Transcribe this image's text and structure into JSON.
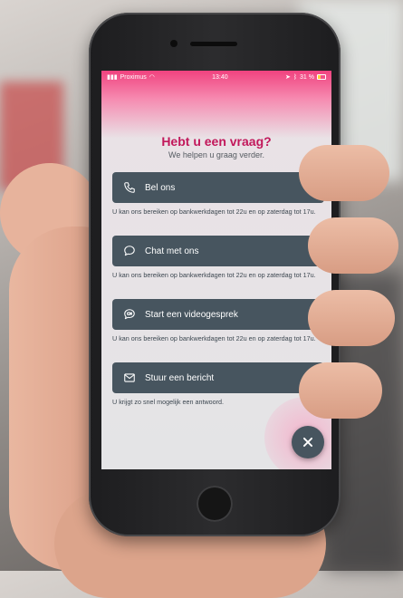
{
  "status_bar": {
    "carrier": "Proximus",
    "time": "13:40",
    "battery": "31 %"
  },
  "header": {
    "title": "Hebt u een vraag?",
    "subtitle": "We helpen u graag verder."
  },
  "options": [
    {
      "label": "Bel ons",
      "icon": "phone-icon",
      "note": "U kan ons bereiken op bankwerkdagen tot 22u en op zaterdag tot 17u."
    },
    {
      "label": "Chat met ons",
      "icon": "chat-bubble-icon",
      "note": "U kan ons bereiken op bankwerkdagen tot 22u en op zaterdag tot 17u."
    },
    {
      "label": "Start een videogesprek",
      "icon": "video-call-icon",
      "note": "U kan ons bereiken op bankwerkdagen tot 22u en op zaterdag tot 17u."
    },
    {
      "label": "Stuur een bericht",
      "icon": "envelope-icon",
      "note": "U krijgt zo snel mogelijk een antwoord."
    }
  ],
  "colors": {
    "accent_pink": "#c2185b",
    "button_bg": "#47555f",
    "status_gradient": "#f0437f"
  }
}
